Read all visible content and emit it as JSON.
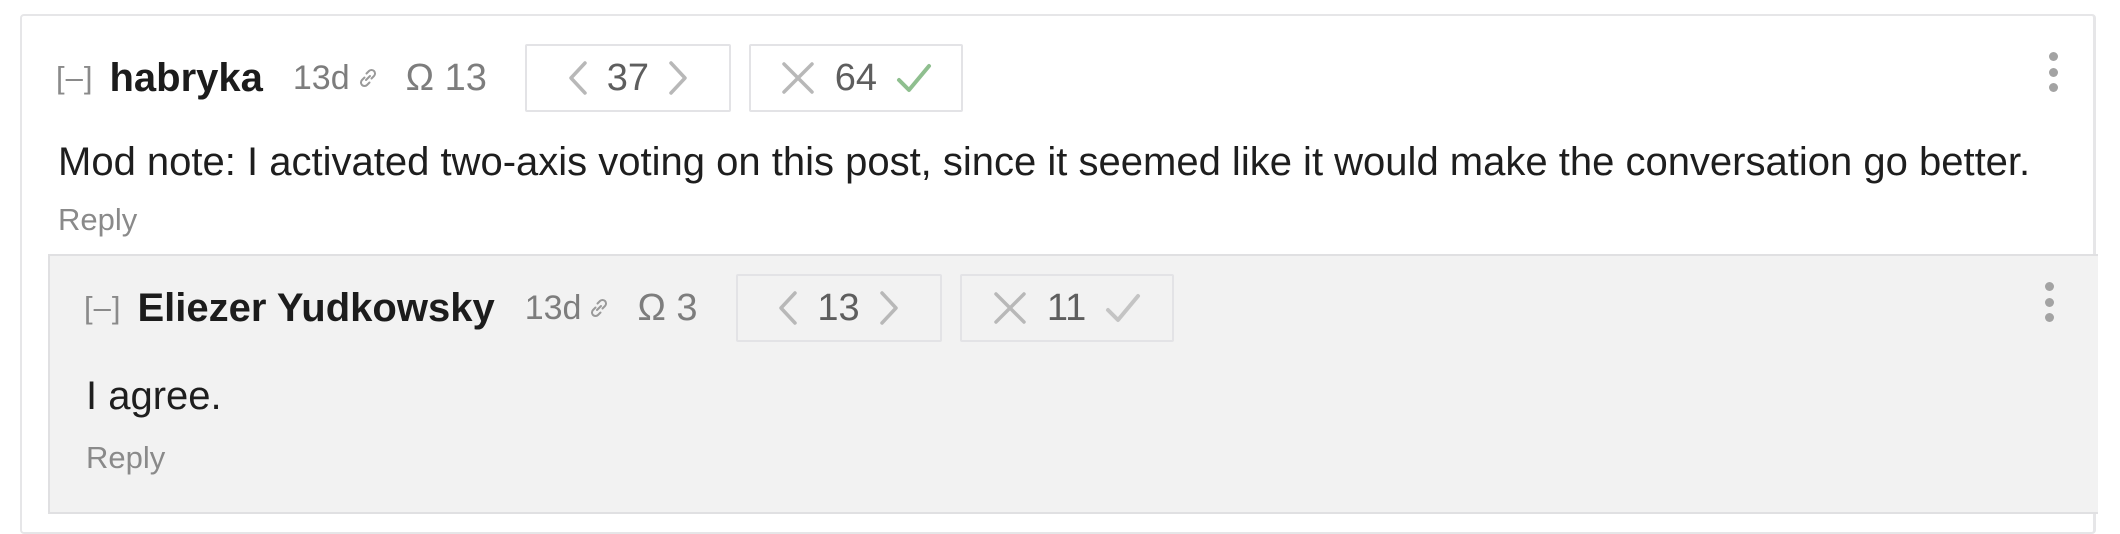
{
  "parent": {
    "collapse": "[–]",
    "author": "habryka",
    "age": "13d",
    "omega": "Ω 13",
    "karma": "37",
    "agreement": "64",
    "body": "Mod note: I activated two-axis voting on this post, since it seemed like it would make the conversation go better.",
    "reply": "Reply"
  },
  "child": {
    "collapse": "[–]",
    "author": "Eliezer Yudkowsky",
    "age": "13d",
    "omega": "Ω 3",
    "karma": "13",
    "agreement": "11",
    "body": "I agree.",
    "reply": "Reply"
  },
  "colors": {
    "agree_active": "#8fbf8f",
    "icon_gray": "#b8b8b8",
    "child_bg": "#f2f2f2"
  },
  "icons": [
    "link-icon",
    "chevron-left-icon",
    "chevron-right-icon",
    "disagree-x-icon",
    "agree-check-icon",
    "more-options-icon"
  ]
}
